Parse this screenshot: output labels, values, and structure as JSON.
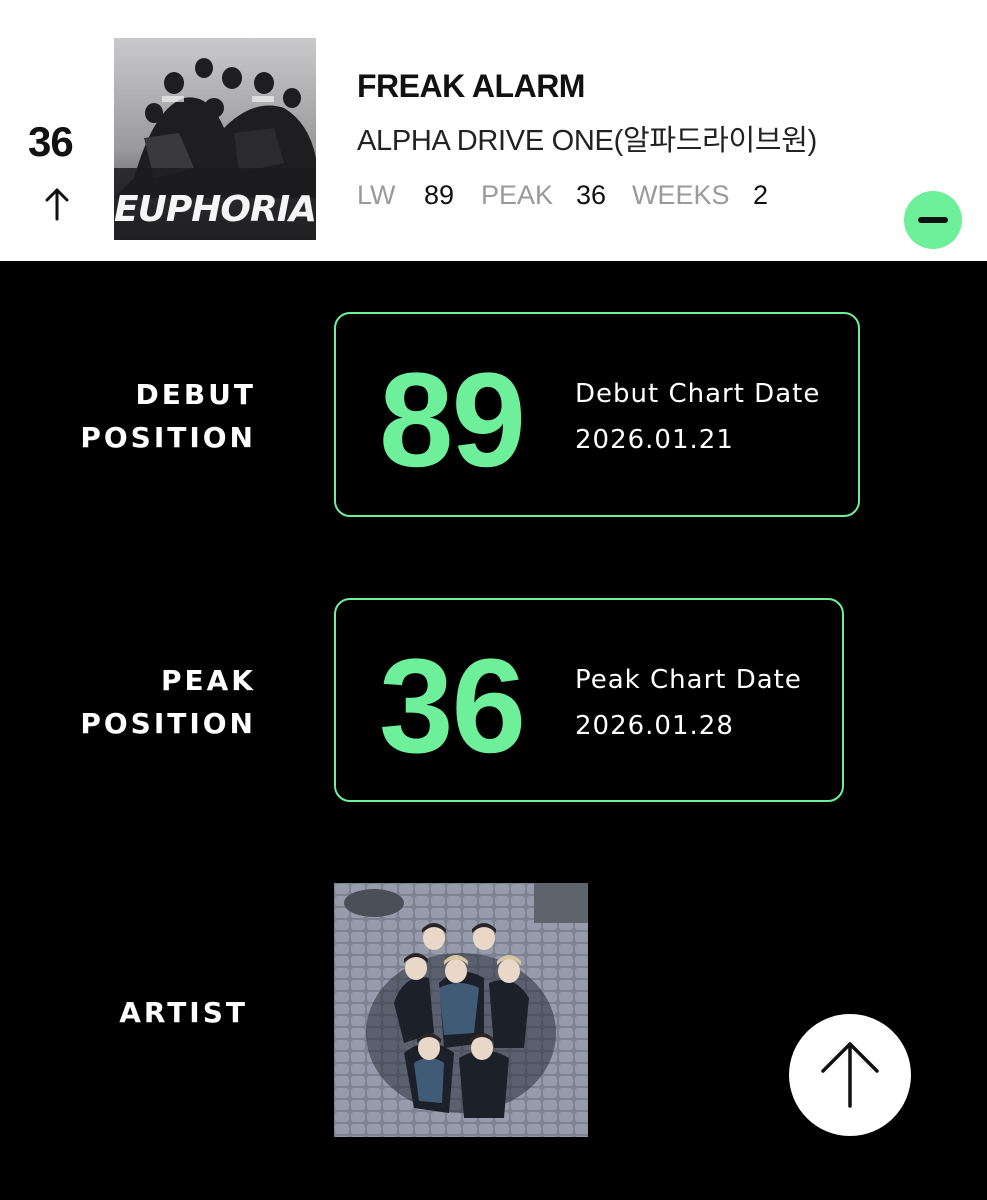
{
  "entry": {
    "rank": "36",
    "rank_trend_icon": "arrow-up-icon",
    "title": "FREAK ALARM",
    "artist": "ALPHA DRIVE ONE(알파드라이브원)",
    "album_art_text": "EUPHORIA",
    "stats": {
      "lw_label": "LW",
      "lw_value": "89",
      "peak_label": "PEAK",
      "peak_value": "36",
      "weeks_label": "WEEKS",
      "weeks_value": "2"
    },
    "collapse_icon": "minus-icon"
  },
  "details": {
    "debut": {
      "label_line1": "DEBUT",
      "label_line2": "POSITION",
      "position": "89",
      "date_label": "Debut Chart Date",
      "date": "2026.01.21"
    },
    "peak": {
      "label_line1": "PEAK",
      "label_line2": "POSITION",
      "position": "36",
      "date_label": "Peak Chart Date",
      "date": "2026.01.28"
    },
    "artist_label": "ARTIST"
  },
  "scroll_top_icon": "arrow-up-icon",
  "colors": {
    "accent": "#6ef09a",
    "background": "#000000",
    "header_background": "#ffffff",
    "muted_text": "#9a9a9a"
  }
}
